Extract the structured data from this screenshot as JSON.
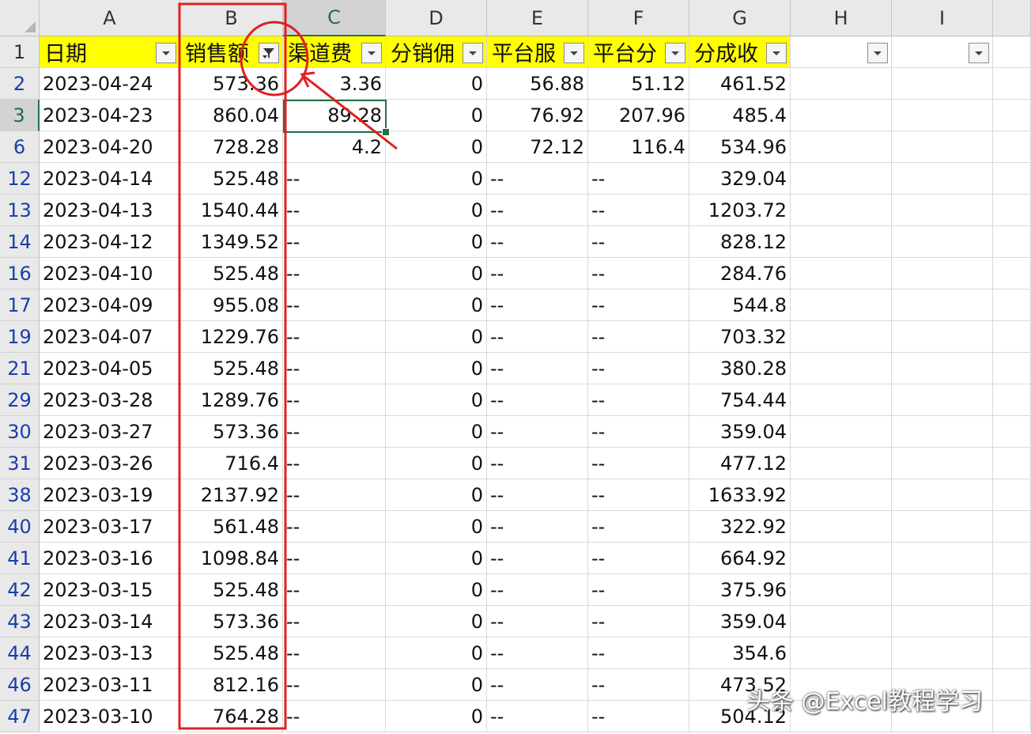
{
  "columns": [
    "A",
    "B",
    "C",
    "D",
    "E",
    "F",
    "G",
    "H",
    "I"
  ],
  "header_row_number": "1",
  "headers": [
    "日期",
    "销售额",
    "渠道费",
    "分销佣",
    "平台服",
    "平台分",
    "分成收",
    "",
    ""
  ],
  "rows": [
    {
      "n": "2",
      "a": "2023-04-24",
      "b": "573.36",
      "c": "3.36",
      "d": "0",
      "e": "56.88",
      "f": "51.12",
      "g": "461.52"
    },
    {
      "n": "3",
      "a": "2023-04-23",
      "b": "860.04",
      "c": "89.28",
      "d": "0",
      "e": "76.92",
      "f": "207.96",
      "g": "485.4"
    },
    {
      "n": "6",
      "a": "2023-04-20",
      "b": "728.28",
      "c": "4.2",
      "d": "0",
      "e": "72.12",
      "f": "116.4",
      "g": "534.96"
    },
    {
      "n": "12",
      "a": "2023-04-14",
      "b": "525.48",
      "c": "--",
      "d": "0",
      "e": "--",
      "f": "--",
      "g": "329.04"
    },
    {
      "n": "13",
      "a": "2023-04-13",
      "b": "1540.44",
      "c": "--",
      "d": "0",
      "e": "--",
      "f": "--",
      "g": "1203.72"
    },
    {
      "n": "14",
      "a": "2023-04-12",
      "b": "1349.52",
      "c": "--",
      "d": "0",
      "e": "--",
      "f": "--",
      "g": "828.12"
    },
    {
      "n": "16",
      "a": "2023-04-10",
      "b": "525.48",
      "c": "--",
      "d": "0",
      "e": "--",
      "f": "--",
      "g": "284.76"
    },
    {
      "n": "17",
      "a": "2023-04-09",
      "b": "955.08",
      "c": "--",
      "d": "0",
      "e": "--",
      "f": "--",
      "g": "544.8"
    },
    {
      "n": "19",
      "a": "2023-04-07",
      "b": "1229.76",
      "c": "--",
      "d": "0",
      "e": "--",
      "f": "--",
      "g": "703.32"
    },
    {
      "n": "21",
      "a": "2023-04-05",
      "b": "525.48",
      "c": "--",
      "d": "0",
      "e": "--",
      "f": "--",
      "g": "380.28"
    },
    {
      "n": "29",
      "a": "2023-03-28",
      "b": "1289.76",
      "c": "--",
      "d": "0",
      "e": "--",
      "f": "--",
      "g": "754.44"
    },
    {
      "n": "30",
      "a": "2023-03-27",
      "b": "573.36",
      "c": "--",
      "d": "0",
      "e": "--",
      "f": "--",
      "g": "359.04"
    },
    {
      "n": "31",
      "a": "2023-03-26",
      "b": "716.4",
      "c": "--",
      "d": "0",
      "e": "--",
      "f": "--",
      "g": "477.12"
    },
    {
      "n": "38",
      "a": "2023-03-19",
      "b": "2137.92",
      "c": "--",
      "d": "0",
      "e": "--",
      "f": "--",
      "g": "1633.92"
    },
    {
      "n": "40",
      "a": "2023-03-17",
      "b": "561.48",
      "c": "--",
      "d": "0",
      "e": "--",
      "f": "--",
      "g": "322.92"
    },
    {
      "n": "41",
      "a": "2023-03-16",
      "b": "1098.84",
      "c": "--",
      "d": "0",
      "e": "--",
      "f": "--",
      "g": "664.92"
    },
    {
      "n": "42",
      "a": "2023-03-15",
      "b": "525.48",
      "c": "--",
      "d": "0",
      "e": "--",
      "f": "--",
      "g": "375.96"
    },
    {
      "n": "43",
      "a": "2023-03-14",
      "b": "573.36",
      "c": "--",
      "d": "0",
      "e": "--",
      "f": "--",
      "g": "359.04"
    },
    {
      "n": "44",
      "a": "2023-03-13",
      "b": "525.48",
      "c": "--",
      "d": "0",
      "e": "--",
      "f": "--",
      "g": "354.6"
    },
    {
      "n": "46",
      "a": "2023-03-11",
      "b": "812.16",
      "c": "--",
      "d": "0",
      "e": "--",
      "f": "--",
      "g": "473.52"
    },
    {
      "n": "47",
      "a": "2023-03-10",
      "b": "764.28",
      "c": "--",
      "d": "0",
      "e": "--",
      "f": "--",
      "g": "504.12"
    }
  ],
  "filtered_column": "B",
  "active_cell": {
    "column": "C",
    "row": "3"
  },
  "watermark": "头条 @Excel教程学习",
  "colors": {
    "header_fill": "#ffff00",
    "annotation": "#e02020",
    "selection": "#217346",
    "row_number": "#1a3fa8"
  }
}
